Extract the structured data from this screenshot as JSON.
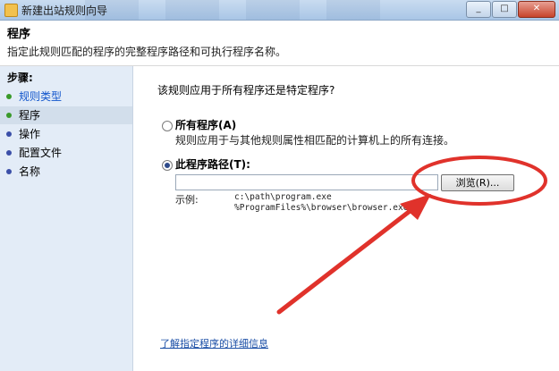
{
  "window": {
    "title": "新建出站规则向导"
  },
  "header": {
    "title": "程序",
    "description": "指定此规则匹配的程序的完整程序路径和可执行程序名称。"
  },
  "sidebar": {
    "steps_title": "步骤:",
    "steps": [
      {
        "label": "规则类型"
      },
      {
        "label": "程序"
      },
      {
        "label": "操作"
      },
      {
        "label": "配置文件"
      },
      {
        "label": "名称"
      }
    ]
  },
  "main": {
    "question": "该规则应用于所有程序还是特定程序?",
    "option_all": {
      "label": "所有程序(A)",
      "description": "规则应用于与其他规则属性相匹配的计算机上的所有连接。",
      "selected": false
    },
    "option_path": {
      "label": "此程序路径(T):",
      "selected": true,
      "input_value": "",
      "browse_label": "浏览(R)...",
      "example_label": "示例:",
      "example_lines": [
        "c:\\path\\program.exe",
        "%ProgramFiles%\\browser\\browser.exe"
      ]
    },
    "learn_more_link": "了解指定程序的详细信息"
  },
  "colors": {
    "annotation_red": "#e0322b",
    "step_active_dot": "#3a9a2a",
    "step_pending_dot": "#3b4fa8",
    "link": "#1a4ea6"
  }
}
